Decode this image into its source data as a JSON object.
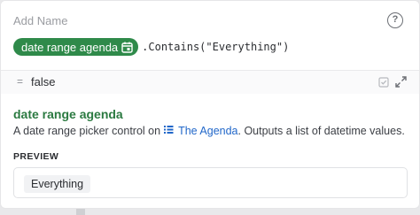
{
  "header": {
    "title": "Add Name",
    "help_icon": "question-circle-icon"
  },
  "expression": {
    "token_label": "date range agenda",
    "token_icon": "calendar-icon",
    "method": ".Contains(\"Everything\")",
    "token_color": "#2f8a4a"
  },
  "result": {
    "operator": "=",
    "value": "false"
  },
  "info": {
    "title": "date range agenda",
    "description_prefix": "A date range picker control on",
    "link_text": "The Agenda",
    "description_suffix": ". Outputs a list of datetime values.",
    "title_color": "#2b7a41",
    "link_color": "#2167c9"
  },
  "preview": {
    "label": "PREVIEW",
    "value": "Everything"
  }
}
